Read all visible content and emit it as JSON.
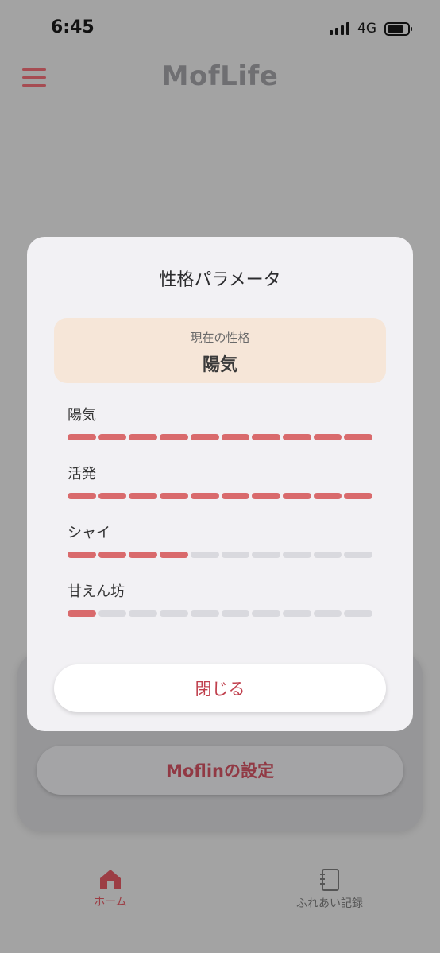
{
  "status_bar": {
    "time": "6:45",
    "network": "4G"
  },
  "header": {
    "title": "MofLife"
  },
  "background": {
    "settings_button_label": "Moflinの設定"
  },
  "tabs": [
    {
      "label": "ホーム",
      "icon": "home-icon"
    },
    {
      "label": "ふれあい記録",
      "icon": "notebook-icon"
    }
  ],
  "modal": {
    "title": "性格パラメータ",
    "current_label": "現在の性格",
    "current_value": "陽気",
    "parameters": [
      {
        "label": "陽気",
        "level": 10,
        "max": 10
      },
      {
        "label": "活発",
        "level": 10,
        "max": 10
      },
      {
        "label": "シャイ",
        "level": 4,
        "max": 10
      },
      {
        "label": "甘えん坊",
        "level": 1,
        "max": 10
      }
    ],
    "close_label": "閉じる"
  },
  "colors": {
    "accent": "#c0404d",
    "bar_filled": "#d96a6c",
    "bar_empty": "#d9d9de",
    "current_box": "#f6e6d8",
    "overlay_bg": "#a3a3a3"
  }
}
